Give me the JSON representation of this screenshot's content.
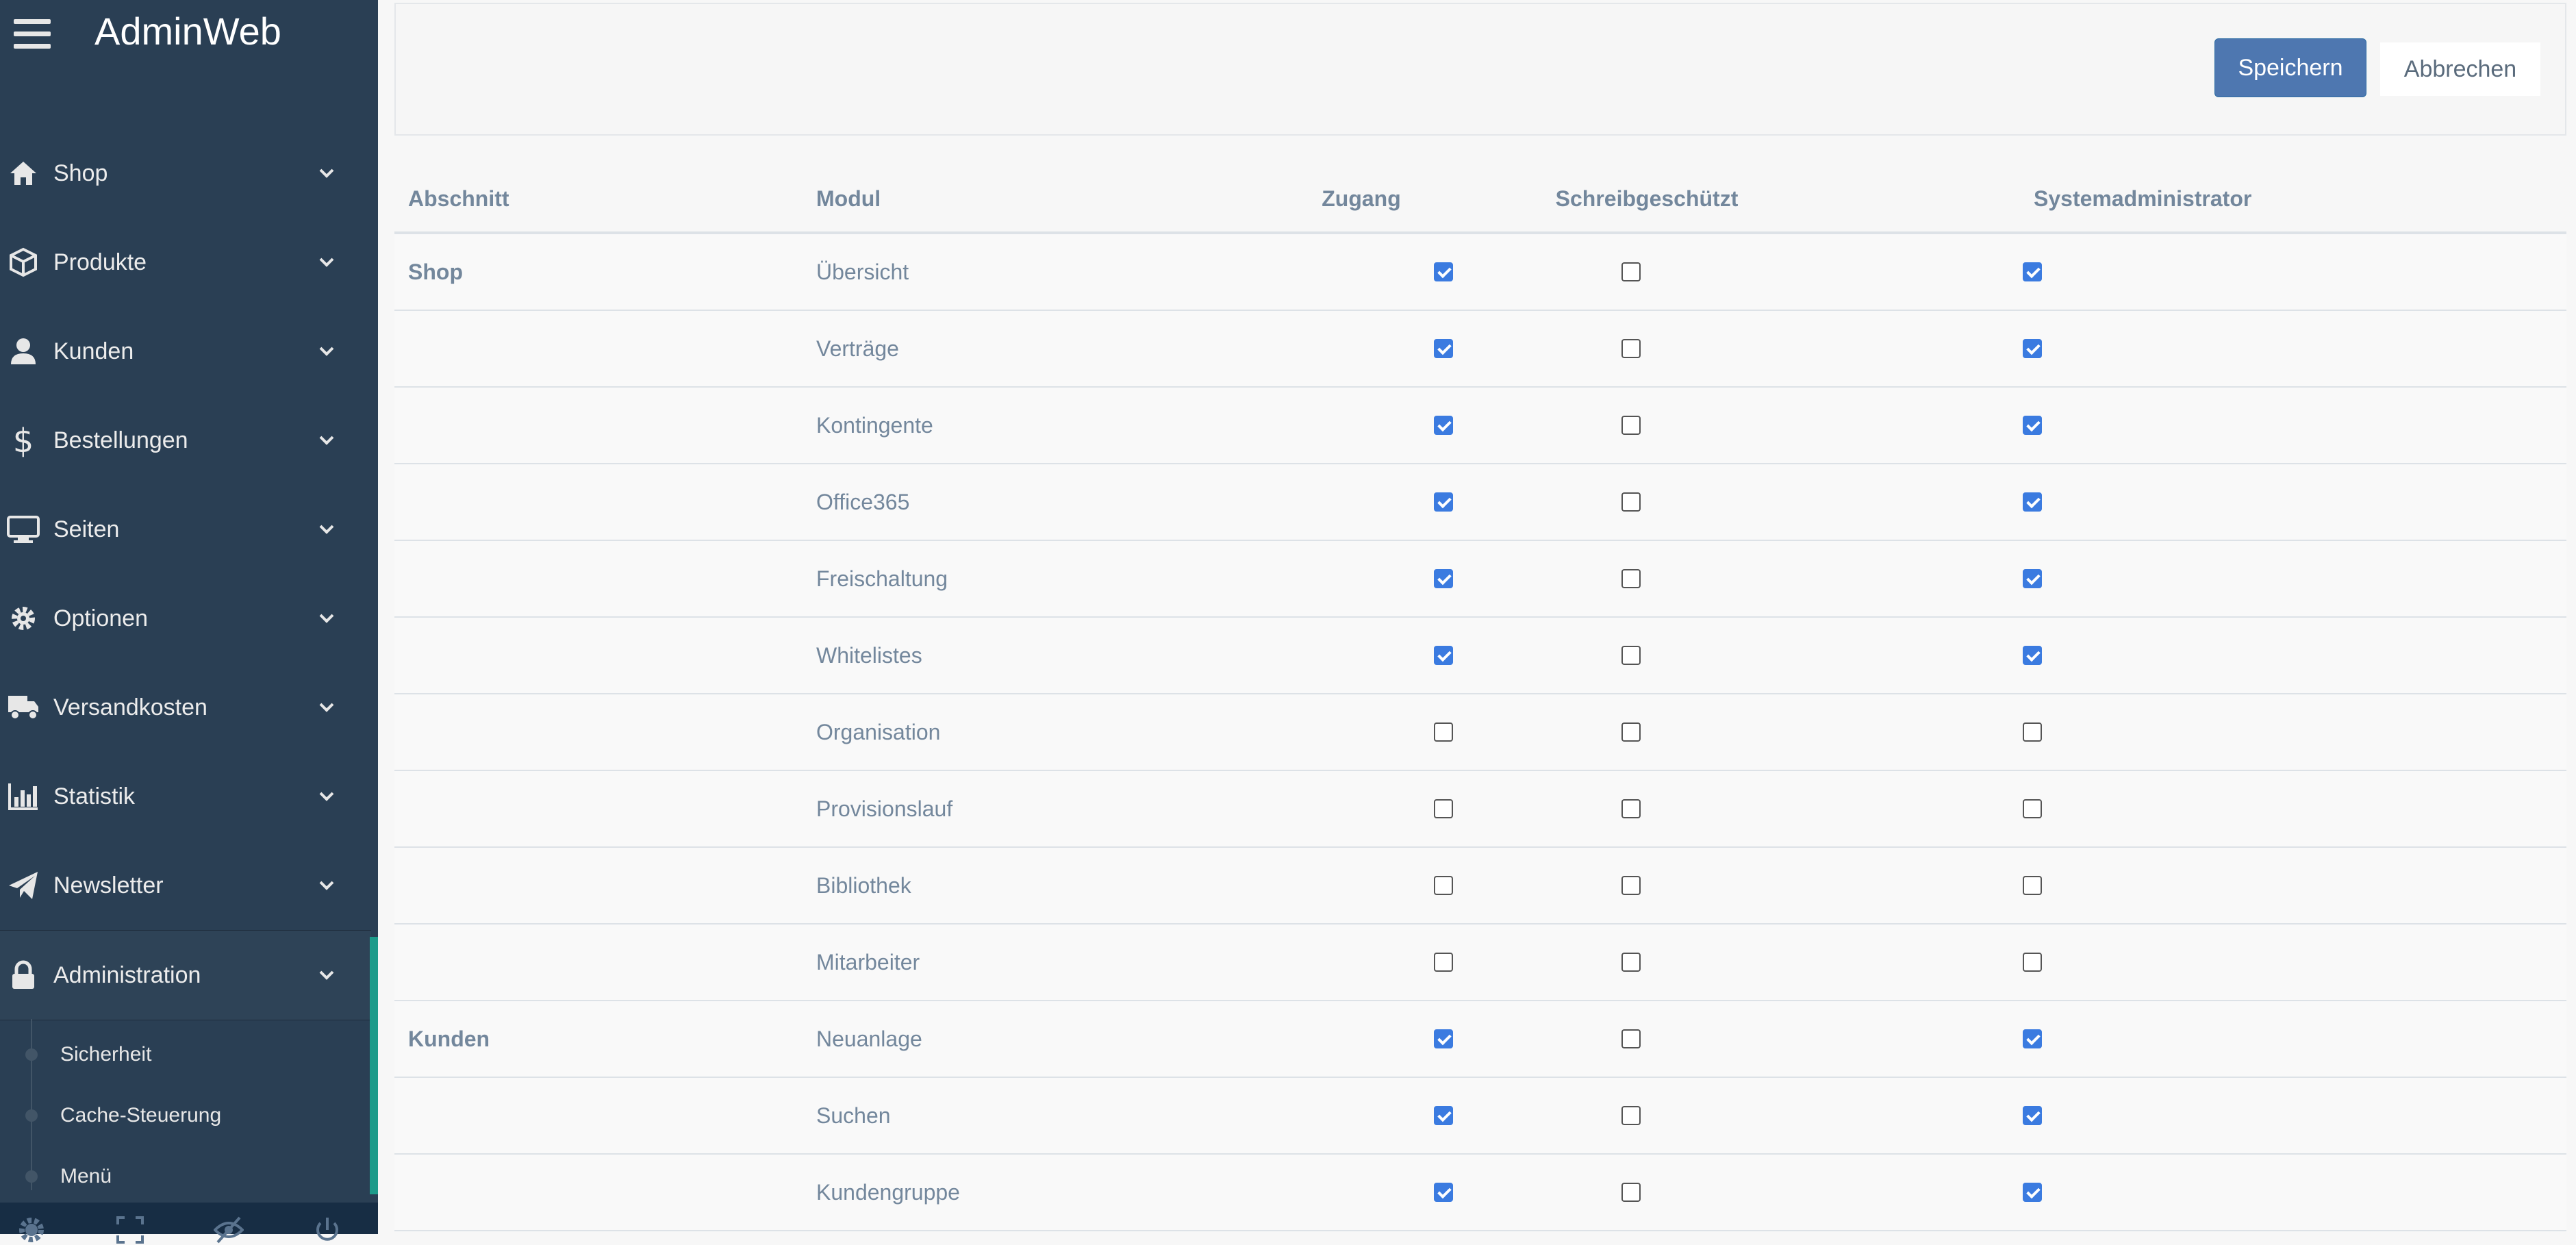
{
  "app": {
    "title": "AdminWeb"
  },
  "sidebar": {
    "items": [
      {
        "label": "Shop",
        "icon": "home-icon"
      },
      {
        "label": "Produkte",
        "icon": "cube-icon"
      },
      {
        "label": "Kunden",
        "icon": "user-icon"
      },
      {
        "label": "Bestellungen",
        "icon": "dollar-icon"
      },
      {
        "label": "Seiten",
        "icon": "desktop-icon"
      },
      {
        "label": "Optionen",
        "icon": "gear-icon"
      },
      {
        "label": "Versandkosten",
        "icon": "truck-icon"
      },
      {
        "label": "Statistik",
        "icon": "bar-chart-icon"
      },
      {
        "label": "Newsletter",
        "icon": "paper-plane-icon"
      },
      {
        "label": "Administration",
        "icon": "lock-icon",
        "active": true
      }
    ],
    "subitems": [
      {
        "label": "Sicherheit"
      },
      {
        "label": "Cache-Steuerung"
      },
      {
        "label": "Menü"
      }
    ],
    "footer_icons": [
      "gear-icon",
      "fullscreen-icon",
      "eye-slash-icon",
      "power-icon"
    ]
  },
  "toolbar": {
    "save_label": "Speichern",
    "cancel_label": "Abbrechen"
  },
  "table": {
    "headers": {
      "section": "Abschnitt",
      "module": "Modul",
      "access": "Zugang",
      "readonly": "Schreibgeschützt",
      "sysadmin": "Systemadministrator"
    },
    "rows": [
      {
        "section": "Shop",
        "module": "Übersicht",
        "access": true,
        "readonly": false,
        "sysadmin": true
      },
      {
        "section": "",
        "module": "Verträge",
        "access": true,
        "readonly": false,
        "sysadmin": true
      },
      {
        "section": "",
        "module": "Kontingente",
        "access": true,
        "readonly": false,
        "sysadmin": true
      },
      {
        "section": "",
        "module": "Office365",
        "access": true,
        "readonly": false,
        "sysadmin": true
      },
      {
        "section": "",
        "module": "Freischaltung",
        "access": true,
        "readonly": false,
        "sysadmin": true
      },
      {
        "section": "",
        "module": "Whitelistes",
        "access": true,
        "readonly": false,
        "sysadmin": true
      },
      {
        "section": "",
        "module": "Organisation",
        "access": false,
        "readonly": false,
        "sysadmin": false
      },
      {
        "section": "",
        "module": "Provisionslauf",
        "access": false,
        "readonly": false,
        "sysadmin": false
      },
      {
        "section": "",
        "module": "Bibliothek",
        "access": false,
        "readonly": false,
        "sysadmin": false
      },
      {
        "section": "",
        "module": "Mitarbeiter",
        "access": false,
        "readonly": false,
        "sysadmin": false
      },
      {
        "section": "Kunden",
        "module": "Neuanlage",
        "access": true,
        "readonly": false,
        "sysadmin": true
      },
      {
        "section": "",
        "module": "Suchen",
        "access": true,
        "readonly": false,
        "sysadmin": true
      },
      {
        "section": "",
        "module": "Kundengruppe",
        "access": true,
        "readonly": false,
        "sysadmin": true
      }
    ]
  },
  "colors": {
    "sidebar": "#2a3f54",
    "accent": "#1abb9c",
    "primary_button": "#4e77b0",
    "checkbox_on": "#3b7be0"
  }
}
